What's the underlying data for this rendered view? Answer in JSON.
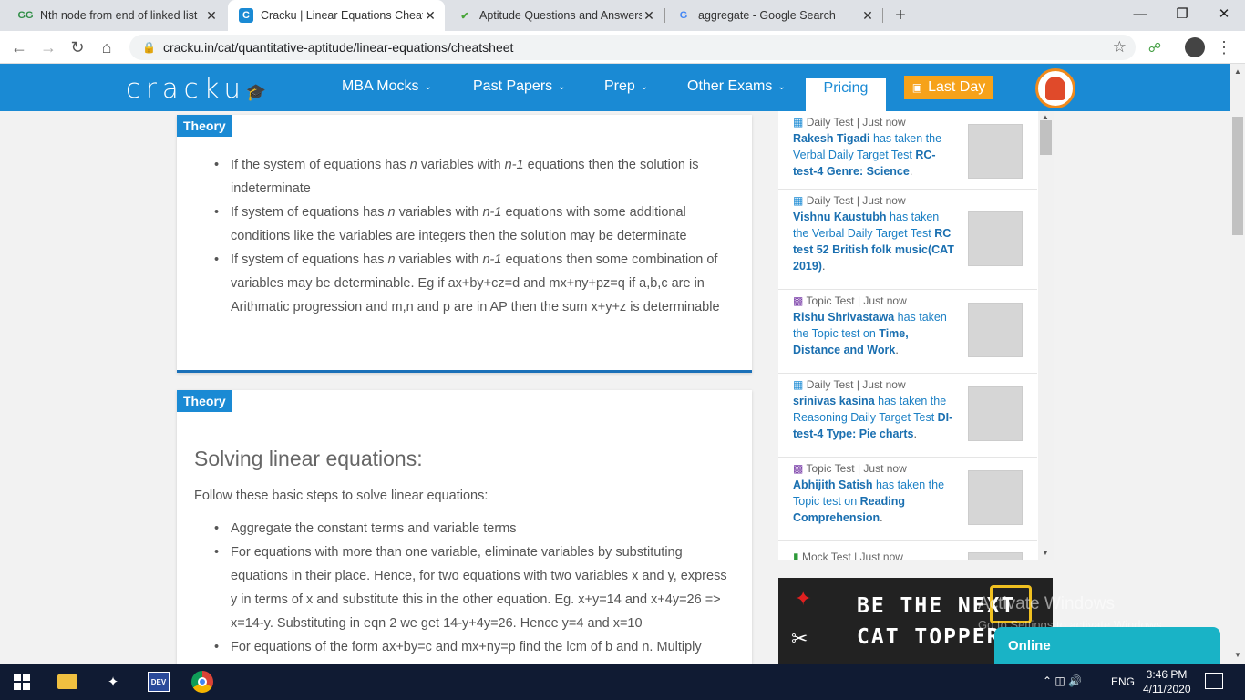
{
  "browser": {
    "tabs": [
      {
        "title": "Nth node from end of linked list",
        "favicon": "GG",
        "fav_color": "#2f8d46"
      },
      {
        "title": "Cracku | Linear Equations Cheatsh",
        "favicon": "C",
        "fav_color": "#1a8ad4",
        "active": true
      },
      {
        "title": "Aptitude Questions and Answers",
        "favicon": "✔",
        "fav_color": "#4aa53a"
      },
      {
        "title": "aggregate - Google Search",
        "favicon": "G",
        "fav_color": "#4285f4"
      }
    ],
    "new_tab": "+",
    "close": "✕",
    "url": "cracku.in/cat/quantitative-aptitude/linear-equations/cheatsheet",
    "win_minimize": "—",
    "win_restore": "❐",
    "win_close": "✕"
  },
  "site": {
    "logo": "cracku",
    "nav": [
      "MBA Mocks",
      "Past Papers",
      "Prep",
      "Other Exams"
    ],
    "pricing": "Pricing",
    "last_day": "Last Day",
    "colors": {
      "brand": "#1a8ad4",
      "accent": "#f6a21a"
    }
  },
  "card1": {
    "badge": "Theory",
    "bullets": [
      {
        "pre": "If the system of equations has ",
        "v1": "n",
        "mid": " variables with ",
        "v2": "n-1",
        "post": " equations then the solution is indeterminate"
      },
      {
        "pre": "If system of equations has ",
        "v1": "n",
        "mid": " variables with ",
        "v2": "n-1",
        "post": " equations with some additional conditions like the variables are integers then the solution may be determinate"
      },
      {
        "pre": "If system of equations has ",
        "v1": "n",
        "mid": " variables with ",
        "v2": "n-1",
        "post": " equations then some combination of variables may be determinable. Eg if ax+by+cz=d and mx+ny+pz=q if a,b,c are in Arithmatic progression and m,n and p are in AP then the sum x+y+z is determinable"
      }
    ]
  },
  "card2": {
    "badge": "Theory",
    "heading": "Solving linear equations:",
    "intro": "Follow these basic steps to solve linear equations:",
    "bullets": [
      "Aggregate the constant terms and variable terms",
      "For equations with more than one variable, eliminate variables by substituting equations in their place. Hence, for two equations with two variables x and y, express y in terms of x and substitute this in the other equation. Eg. x+y=14 and x+4y=26 => x=14-y. Substituting in eqn 2 we get 14-y+4y=26. Hence y=4 and x=10",
      "For equations of the form ax+by=c and mx+ny=p find the lcm of b and n. Multiply"
    ]
  },
  "feed": [
    {
      "type": "Daily Test",
      "time": "Just now",
      "name": "Rakesh Tigadi",
      "action": " has taken the Verbal Daily Target Test ",
      "test": "RC-test-4 Genre: Science",
      "end": "."
    },
    {
      "type": "Daily Test",
      "time": "Just now",
      "name": "Vishnu Kaustubh",
      "action": " has taken the Verbal Daily Target Test ",
      "test": "RC test 52 British folk music(CAT 2019)",
      "end": "."
    },
    {
      "type": "Topic Test",
      "time": "Just now",
      "name": "Rishu Shrivastawa",
      "action": " has taken the Topic test on ",
      "test": "Time, Distance and Work",
      "end": "."
    },
    {
      "type": "Daily Test",
      "time": "Just now",
      "name": "srinivas kasina",
      "action": " has taken the Reasoning Daily Target Test ",
      "test": "DI-test-4 Type: Pie charts",
      "end": "."
    },
    {
      "type": "Topic Test",
      "time": "Just now",
      "name": "Abhijith Satish",
      "action": " has taken the Topic test on ",
      "test": "Reading Comprehension",
      "end": "."
    },
    {
      "type": "Mock Test",
      "time": "Just now",
      "name": "",
      "action": "",
      "test": "",
      "end": ""
    }
  ],
  "ad": {
    "line1": "BE THE NEXT",
    "line2": "CAT TOPPER"
  },
  "online": "Online",
  "watermark": {
    "line1": "Activate Windows",
    "line2": "Go to Settings to activate Windows."
  },
  "taskbar": {
    "lang": "ENG",
    "time": "3:46 PM",
    "date": "4/11/2020"
  }
}
